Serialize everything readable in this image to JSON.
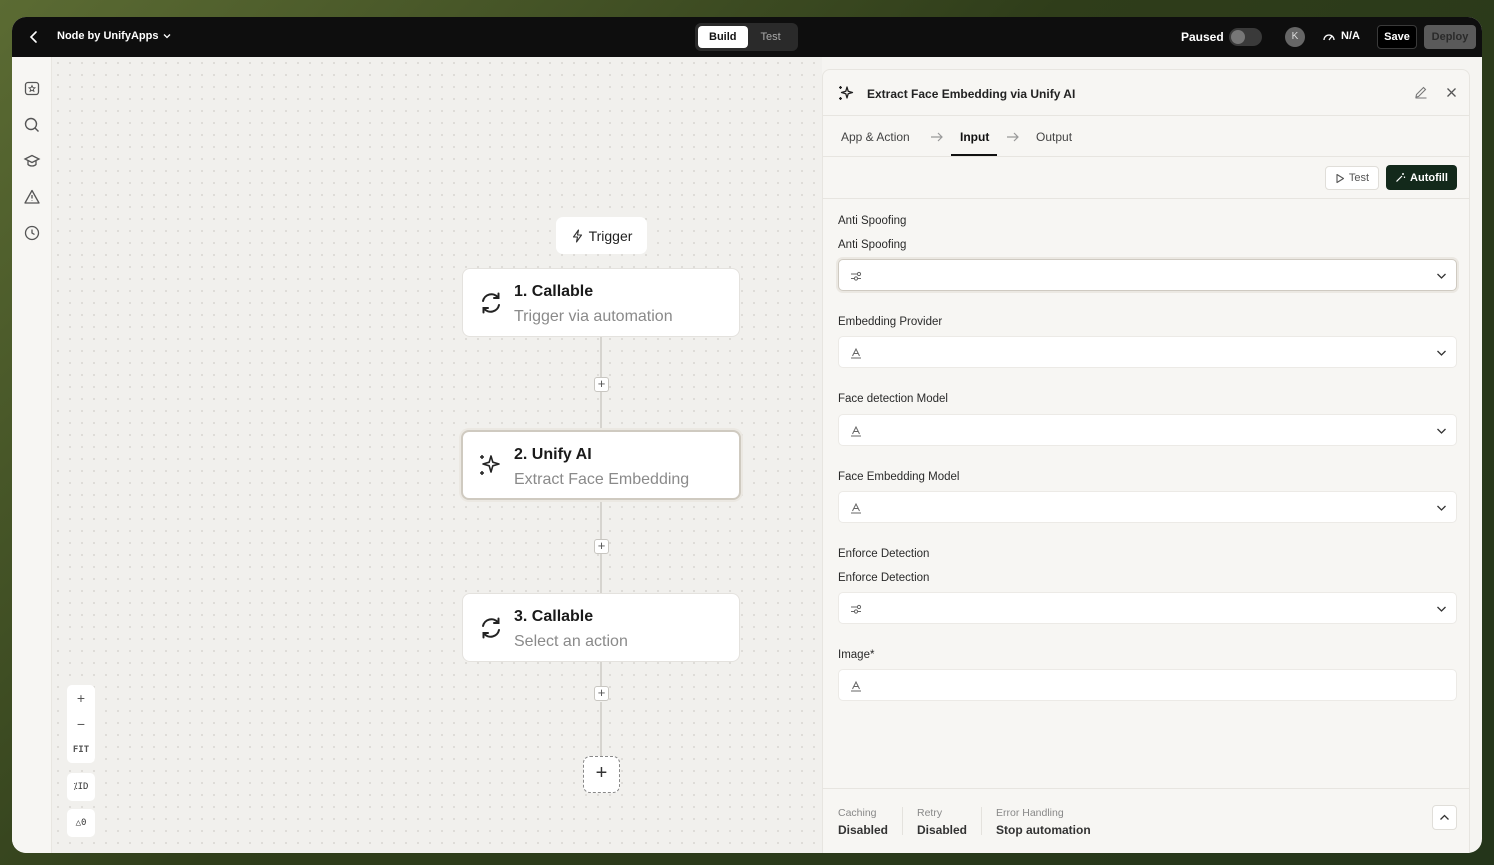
{
  "topbar": {
    "app_title": "Node by UnifyApps",
    "modes": [
      "Build",
      "Test"
    ],
    "status_label": "Paused",
    "avatar_initial": "K",
    "metric": "N/A",
    "save_label": "Save",
    "deploy_label": "Deploy"
  },
  "rail": {
    "icons": [
      "bookmark-star-icon",
      "search-icon",
      "graduation-cap-icon",
      "warning-icon",
      "history-icon"
    ]
  },
  "canvas": {
    "trigger_label": "Trigger",
    "nodes": [
      {
        "title": "1. Callable",
        "subtitle": "Trigger via automation"
      },
      {
        "title": "2. Unify AI",
        "subtitle": "Extract Face Embedding"
      },
      {
        "title": "3. Callable",
        "subtitle": "Select an action"
      }
    ],
    "zoom_in": "+",
    "zoom_out": "−",
    "zoom_fit": "FIT",
    "id_chip": "ID",
    "warning_count": "0"
  },
  "panel": {
    "title": "Extract Face Embedding via Unify AI",
    "tabs": [
      "App & Action",
      "Input",
      "Output"
    ],
    "active_tab": "Input",
    "test_label": "Test",
    "autofill_label": "Autofill",
    "fields": [
      {
        "group": "Anti Spoofing",
        "label": "Anti Spoofing",
        "type": "toggle-select"
      },
      {
        "label": "Embedding Provider",
        "type": "text-select"
      },
      {
        "label": "Face detection Model",
        "type": "text-select"
      },
      {
        "label": "Face Embedding Model",
        "type": "text-select"
      },
      {
        "group": "Enforce Detection",
        "label": "Enforce Detection",
        "type": "toggle-select"
      },
      {
        "label": "Image*",
        "type": "text"
      }
    ],
    "footer": {
      "caching_label": "Caching",
      "caching_value": "Disabled",
      "retry_label": "Retry",
      "retry_value": "Disabled",
      "error_label": "Error Handling",
      "error_value": "Stop automation"
    }
  }
}
